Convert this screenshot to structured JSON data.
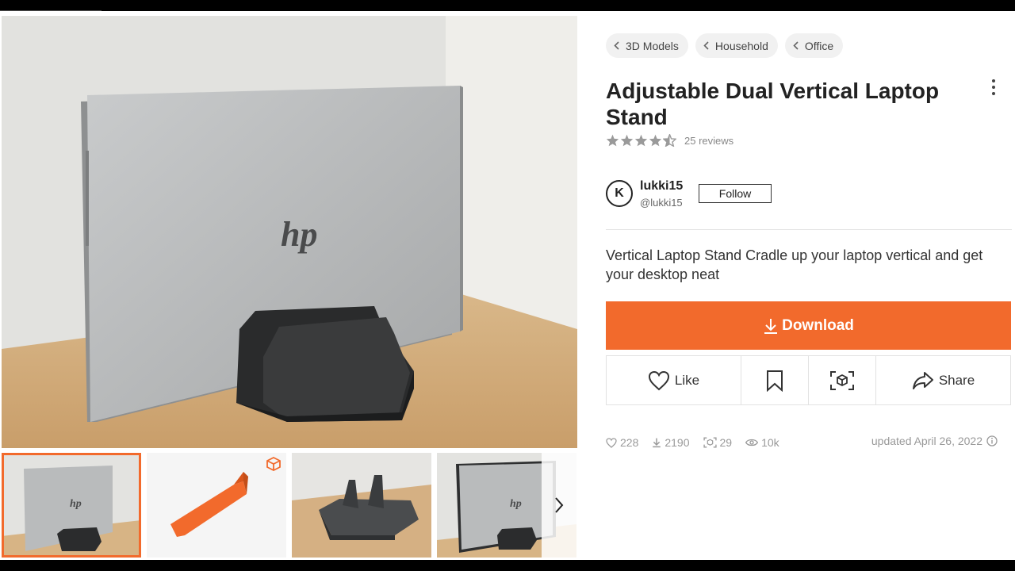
{
  "breadcrumbs": [
    {
      "label": "3D Models"
    },
    {
      "label": "Household"
    },
    {
      "label": "Office"
    }
  ],
  "model": {
    "title": "Adjustable Dual Vertical Laptop Stand",
    "rating": 4.5,
    "reviews_label": "25 reviews",
    "description": "Vertical Laptop Stand Cradle up your laptop vertical and get your desktop neat"
  },
  "author": {
    "avatar_letter": "K",
    "name": "lukki15",
    "handle": "@lukki15",
    "follow_label": "Follow"
  },
  "actions": {
    "download_label": "Download",
    "like_label": "Like",
    "share_label": "Share"
  },
  "stats": {
    "likes": "228",
    "downloads": "2190",
    "makes": "29",
    "views": "10k",
    "updated": "updated April 26, 2022"
  },
  "gallery": {
    "logo_text": "hp",
    "thumbnails": [
      {
        "kind": "photo-laptop-in-stand",
        "active": true
      },
      {
        "kind": "3d-model-preview",
        "badge": "cube-icon"
      },
      {
        "kind": "photo-empty-stand"
      },
      {
        "kind": "photo-laptop-in-stand-side"
      }
    ]
  },
  "colors": {
    "accent": "#f26a2c",
    "star": "#999999"
  }
}
